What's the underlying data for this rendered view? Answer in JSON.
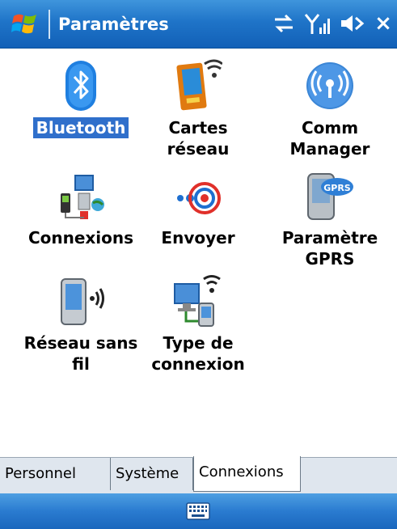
{
  "window": {
    "title": "Paramètres",
    "close_symbol": "×"
  },
  "status_icons": [
    "connectivity-icon",
    "signal-strength-icon",
    "volume-icon"
  ],
  "items": [
    {
      "label": "Bluetooth",
      "icon": "bluetooth-icon",
      "selected": true
    },
    {
      "label": "Cartes\nréseau",
      "icon": "network-cards-icon",
      "selected": false
    },
    {
      "label": "Comm\nManager",
      "icon": "comm-manager-icon",
      "selected": false
    },
    {
      "label": "Connexions",
      "icon": "connections-icon",
      "selected": false
    },
    {
      "label": "Envoyer",
      "icon": "beam-icon",
      "selected": false
    },
    {
      "label": "Paramètre\nGPRS",
      "icon": "gprs-settings-icon",
      "selected": false
    },
    {
      "label": "Réseau sans\nfil",
      "icon": "wireless-network-icon",
      "selected": false
    },
    {
      "label": "Type de\nconnexion",
      "icon": "connection-type-icon",
      "selected": false
    }
  ],
  "tabs": [
    {
      "label": "Personnel",
      "active": false
    },
    {
      "label": "Système",
      "active": false
    },
    {
      "label": "Connexions",
      "active": true
    }
  ],
  "softbar": {
    "keyboard_icon": "keyboard-icon"
  },
  "colors": {
    "titlebar": "#1f74c8",
    "selection": "#2f6fcb",
    "tabbar": "#dfe6ee"
  }
}
